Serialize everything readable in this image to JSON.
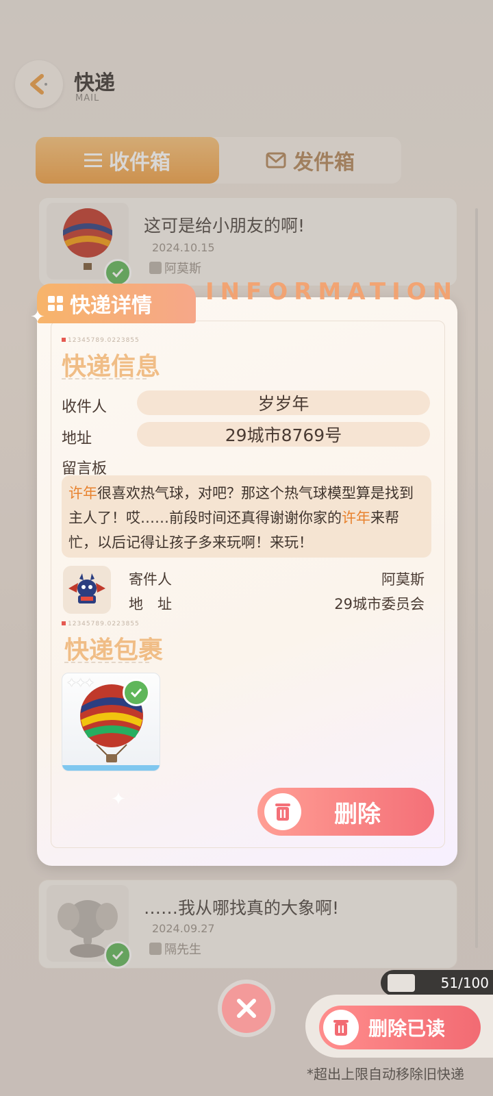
{
  "header": {
    "title": "快递",
    "subtitle": "MAIL"
  },
  "tabs": {
    "inbox": "收件箱",
    "outbox": "发件箱"
  },
  "mail_list": [
    {
      "subject": "这可是给小朋友的啊!",
      "date": "2024.10.15",
      "sender": "阿莫斯"
    },
    {
      "subject": "……我从哪找真的大象啊!",
      "date": "2024.09.27",
      "sender": "隔先生"
    }
  ],
  "modal": {
    "tab_label": "快递详情",
    "banner_word": "INFORMATION",
    "serial": "12345789.0223855",
    "info_title": "快递信息",
    "recipient_label": "收件人",
    "recipient_value": "岁岁年",
    "address_label": "地址",
    "address_value": "29城市8769号",
    "message_label": "留言板",
    "message_parts": {
      "p1": "许年",
      "p2": "很喜欢热气球，对吧？那这个热气球模型算是找到主人了！哎……前段时间还真得谢谢你家的",
      "p3": "许年",
      "p4": "来帮忙，以后记得让孩子多来玩啊！来玩！"
    },
    "sender_label": "寄件人",
    "sender_value": "阿莫斯",
    "sender_addr_label": "地　址",
    "sender_addr_value": "29城市委员会",
    "package_title": "快递包裹",
    "item_icon": "hot-air-balloon",
    "delete_label": "删除"
  },
  "footer": {
    "count": "51/100",
    "delete_read": "删除已读",
    "note": "*超出上限自动移除旧快递"
  },
  "colors": {
    "accent": "#ee9f45",
    "danger": "#f26b73",
    "highlight": "#e8822e"
  }
}
